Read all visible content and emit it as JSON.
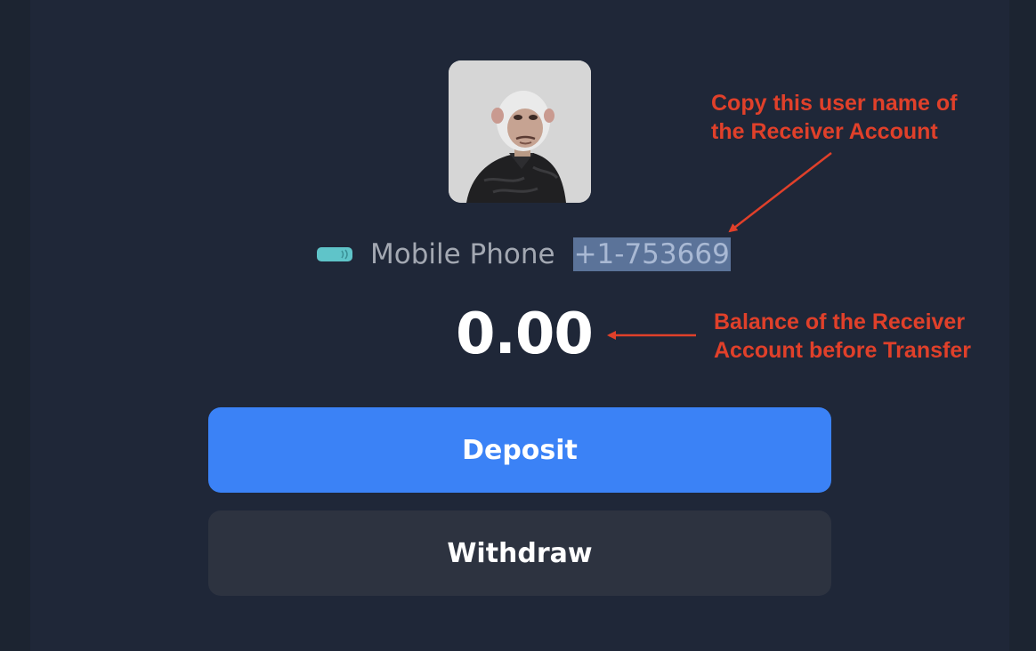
{
  "account": {
    "icon": "phone-icon",
    "label": "Mobile Phone",
    "number": "+1-753669"
  },
  "balance": "0.00",
  "actions": {
    "deposit_label": "Deposit",
    "withdraw_label": "Withdraw"
  },
  "annotations": {
    "username_line1": "Copy this user name of",
    "username_line2": "the Receiver Account",
    "balance_line1": "Balance of the Receiver",
    "balance_line2": "Account before Transfer"
  },
  "colors": {
    "background": "#1f2738",
    "deposit_button": "#3b82f6",
    "withdraw_button": "#2d3340",
    "annotation": "#e0402a",
    "selection_highlight": "#5b7399"
  }
}
